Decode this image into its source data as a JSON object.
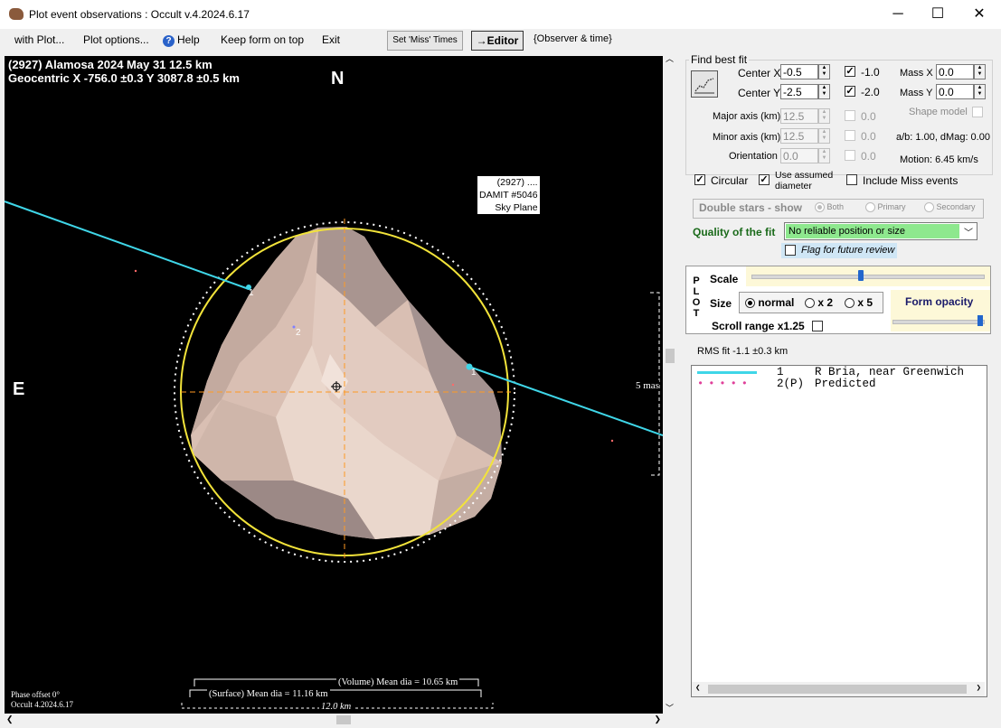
{
  "window": {
    "title": "Plot event observations : Occult v.4.2024.6.17",
    "minimize": "─",
    "maximize": "☐",
    "close": "✕"
  },
  "menu": {
    "with_plot": "with Plot...",
    "plot_options": "Plot options...",
    "help": "Help",
    "keep_on_top": "Keep form on top",
    "exit": "Exit",
    "set_miss_times": "Set 'Miss' Times",
    "editor": "→Editor",
    "observer_time": "{Observer & time}"
  },
  "plot": {
    "header_line1": "(2927) Alamosa  2024 May 31   12.5 km",
    "header_line2": "Geocentric  X  -756.0 ±0.3  Y  3087.8 ±0.5 km",
    "north": "N",
    "east": "E",
    "shape_label": [
      "(2927) ....",
      "DAMIT #5046",
      "Sky Plane"
    ],
    "scale_label": "5 mas",
    "chord1_a": "1",
    "chord1_b": "1",
    "chord2": "2",
    "phase_offset": "Phase offset 0°",
    "version": "Occult 4.2024.6.17",
    "volume_mean": "(Volume) Mean dia = 10.65 km",
    "surface_mean": "(Surface) Mean dia = 11.16 km",
    "scale_km": "12.0 km"
  },
  "fit": {
    "group_title": "Find best fit",
    "center_x_label": "Center X",
    "center_x": "-0.5",
    "center_y_label": "Center Y",
    "center_y": "-2.5",
    "cx_check": "-1.0",
    "cy_check": "-2.0",
    "mass_x_label": "Mass X",
    "mass_x": "0.0",
    "mass_y_label": "Mass Y",
    "mass_y": "0.0",
    "major_label": "Major axis (km)",
    "major": "12.5",
    "minor_label": "Minor axis (km)",
    "minor": "12.5",
    "orient_label": "Orientation",
    "orient": "0.0",
    "major_chk": "0.0",
    "minor_chk": "0.0",
    "orient_chk": "0.0",
    "shape_model": "Shape model",
    "ab_dmag": "a/b: 1.00, dMag: 0.00",
    "motion": "Motion: 6.45 km/s",
    "circular": "Circular",
    "use_assumed": "Use assumed",
    "diameter": "diameter",
    "include_miss": "Include Miss events"
  },
  "double_stars": {
    "title": "Double stars - show",
    "both": "Both",
    "primary": "Primary",
    "secondary": "Secondary"
  },
  "quality": {
    "label": "Quality of the fit",
    "value": "No reliable position or size",
    "flag": "Flag for future review"
  },
  "plotbox": {
    "letters": [
      "P",
      "L",
      "O",
      "T"
    ],
    "scale": "Scale",
    "size": "Size",
    "normal": "normal",
    "x2": "x 2",
    "x5": "x 5",
    "form_opacity": "Form opacity",
    "scroll_range": "Scroll range x1.25"
  },
  "rms": "RMS fit -1.1 ±0.3 km",
  "legend": [
    {
      "id": "1",
      "name": "R Bria, near Greenwich"
    },
    {
      "id": "2(P)",
      "name": "Predicted"
    }
  ],
  "colors": {
    "chord": "#3fd6e8",
    "fit_ellipse": "#f2e33a",
    "predicted": "#e0409a",
    "quality_bg": "#8ee88e"
  }
}
